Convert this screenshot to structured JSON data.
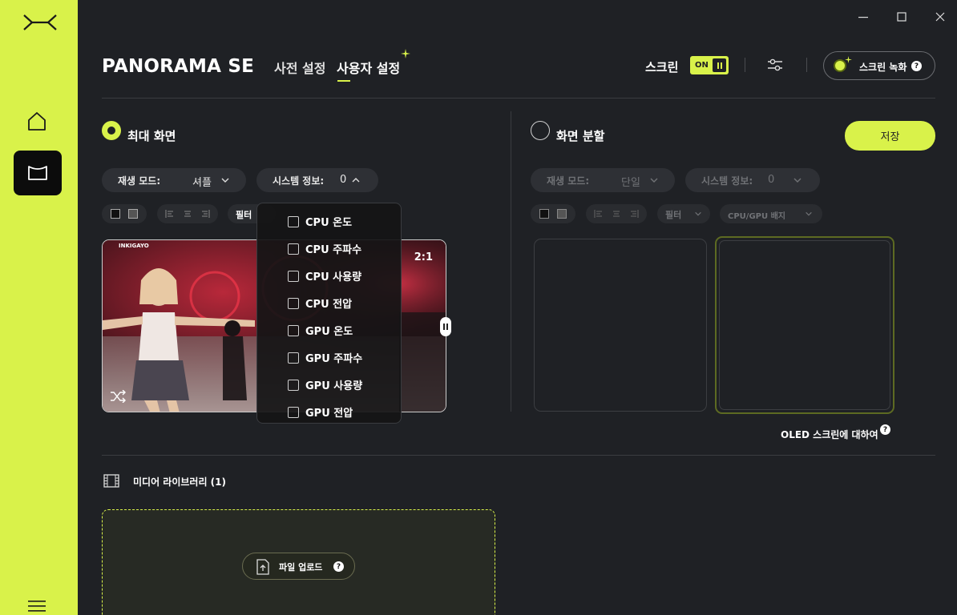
{
  "app": {
    "title": "PANORAMA SE"
  },
  "tabs": [
    {
      "label": "사전 설정"
    },
    {
      "label": "사용자 설정"
    }
  ],
  "header": {
    "screen_label": "스크린",
    "toggle_label": "ON",
    "record_label": "스크린 녹화",
    "help": "?"
  },
  "left_panel": {
    "title": "최대 화면",
    "playback_label": "재생 모드:",
    "playback_value": "셔플",
    "sysinfo_label": "시스템 정보:",
    "sysinfo_value": "0",
    "filter_label": "필터",
    "preview_ratio": "2:1",
    "preview_brand": "INKIGAYO"
  },
  "right_panel": {
    "title": "화면 분할",
    "save_label": "저장",
    "playback_label": "재생 모드:",
    "playback_value": "단일",
    "sysinfo_label": "시스템 정보:",
    "sysinfo_value": "0",
    "filter_label": "필터",
    "badge_label": "CPU/GPU 배지",
    "oled_label": "OLED 스크린에 대하여"
  },
  "sysinfo_dropdown": {
    "options": [
      "CPU 온도",
      "CPU 주파수",
      "CPU 사용량",
      "CPU 전압",
      "GPU 온도",
      "GPU 주파수",
      "GPU 사용량",
      "GPU 전압"
    ]
  },
  "media": {
    "title": "미디어 라이브러리 (1)",
    "upload_label": "파일 업로드"
  },
  "colors": {
    "accent": "#d9f24a",
    "background": "#1f2125"
  }
}
